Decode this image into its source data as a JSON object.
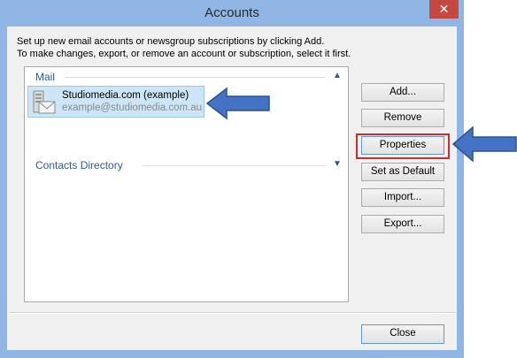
{
  "window": {
    "title": "Accounts",
    "close_glyph": "✕"
  },
  "instructions": {
    "line1": "Set up new email accounts or newsgroup subscriptions by clicking Add.",
    "line2": "To make changes, export, or remove an account or subscription, select it first."
  },
  "groups": {
    "mail": "Mail",
    "contacts": "Contacts Directory"
  },
  "account": {
    "name": "Studiomedia.com (example)",
    "email": "example@studiomedia.com.au"
  },
  "buttons": {
    "add": "Add...",
    "remove": "Remove",
    "properties": "Properties",
    "set_default": "Set as Default",
    "import": "Import...",
    "export": "Export...",
    "close": "Close"
  },
  "colors": {
    "title_bar": "#8fb6e4",
    "annotation_arrow": "#4472c4",
    "highlight": "#d02b2b"
  }
}
